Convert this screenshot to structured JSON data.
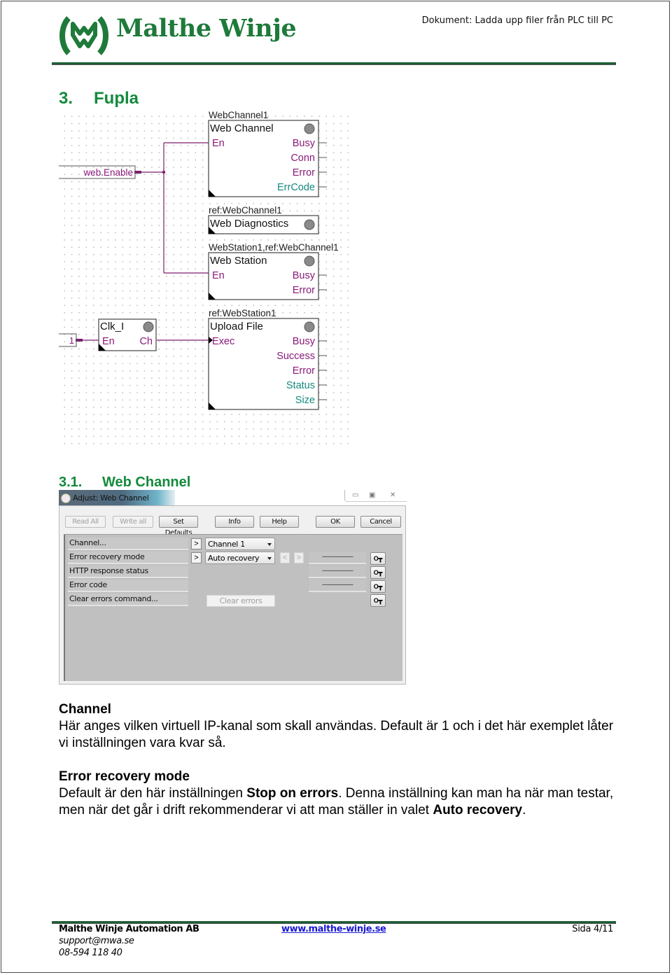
{
  "header": {
    "brand": "Malthe Winje",
    "document_title": "Dokument: Ladda upp filer från PLC till PC",
    "brand_color": "#1e7a3a"
  },
  "section": {
    "number": "3.",
    "title": "Fupla"
  },
  "fupla": {
    "wire_color": "#7a1f6e",
    "input_label_color": "#8a1a7a",
    "output_int_color": "#148a80",
    "inputs": [
      {
        "label": "web.Enable"
      },
      {
        "label": "1"
      }
    ],
    "blocks": [
      {
        "instance": "WebChannel1",
        "title": "Web Channel",
        "inputs": [
          "En"
        ],
        "outputs": [
          "Busy",
          "Conn",
          "Error",
          "ErrCode"
        ]
      },
      {
        "instance": "ref:WebChannel1",
        "title": "Web Diagnostics",
        "inputs": [],
        "outputs": []
      },
      {
        "instance": "WebStation1,ref:WebChannel1",
        "title": "Web Station",
        "inputs": [
          "En"
        ],
        "outputs": [
          "Busy",
          "Error"
        ]
      },
      {
        "instance": "",
        "title": "Clk_I",
        "inputs": [
          "En"
        ],
        "outputs": [
          "Ch"
        ]
      },
      {
        "instance": "ref:WebStation1",
        "title": "Upload File",
        "inputs": [
          "Exec"
        ],
        "outputs": [
          "Busy",
          "Success",
          "Error",
          "Status",
          "Size"
        ]
      }
    ]
  },
  "subsection": {
    "number": "3.1.",
    "title": "Web Channel"
  },
  "dialog": {
    "title": "Adjust: Web Channel",
    "window_buttons": {
      "minimize": "▭",
      "restore": "▣",
      "close": "✕"
    },
    "toolbar": {
      "read_all": "Read All",
      "write_all": "Write all",
      "set_defaults": "Set Defaults",
      "info": "Info",
      "help": "Help",
      "ok": "OK",
      "cancel": "Cancel"
    },
    "properties": [
      {
        "label": "Channel...",
        "value": "Channel 1",
        "status": ""
      },
      {
        "label": "Error recovery mode",
        "value": "Auto recovery",
        "status": "----------------------"
      },
      {
        "label": "HTTP response status",
        "value": "",
        "status": "----------------------"
      },
      {
        "label": "Error code",
        "value": "",
        "status": "----------------------"
      },
      {
        "label": "Clear errors command...",
        "value": "",
        "status": ""
      }
    ],
    "expand_glyph": ">",
    "prev_glyph": "<",
    "next_glyph": ">",
    "key_glyph": "O┳",
    "clear_errors_label": "Clear errors"
  },
  "text": {
    "channel_heading": "Channel",
    "channel_body": "Här anges vilken virtuell IP-kanal som skall användas. Default är 1 och i det här exemplet låter vi inställningen vara kvar så.",
    "erm_heading": "Error recovery mode",
    "erm_body_1": "Default är den här inställningen ",
    "erm_bold_1": "Stop on errors",
    "erm_body_2": ". Denna inställning kan man ha när man testar, men när det går i drift rekommenderar vi att man ställer in valet ",
    "erm_bold_2": "Auto recovery",
    "erm_body_3": "."
  },
  "footer": {
    "company": "Malthe Winje Automation AB",
    "email": "support@mwa.se",
    "phone": "08-594 118 40",
    "website": "www.malthe-winje.se",
    "page": "Sida 4/11"
  }
}
